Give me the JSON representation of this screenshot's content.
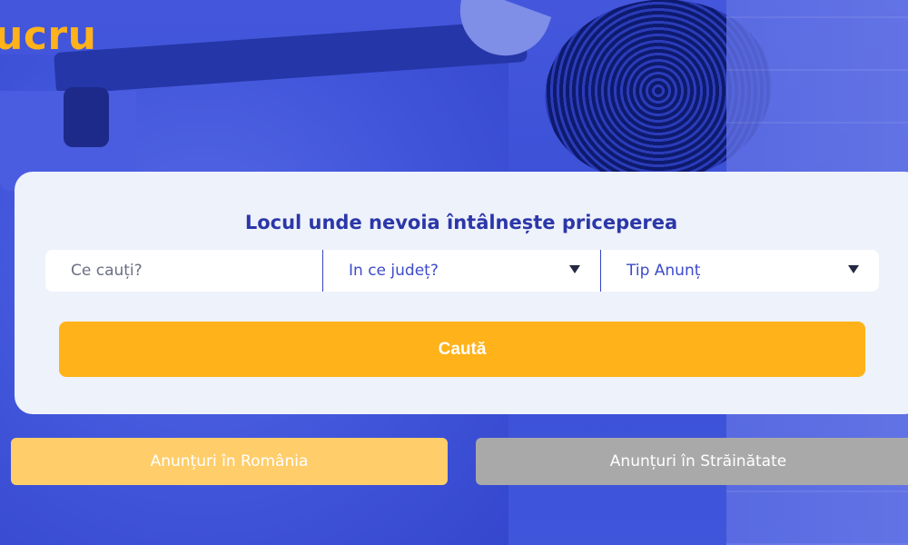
{
  "brand": {
    "logo_text": "ucru",
    "accent_color": "#ffb21a",
    "primary_color": "#2b37a8"
  },
  "search_card": {
    "title": "Locul unde nevoia întâlnește priceperea",
    "query_placeholder": "Ce cauți?",
    "county_select": {
      "label": "In ce județ?",
      "icon": "chevron-down-icon"
    },
    "type_select": {
      "label": "Tip Anunț",
      "icon": "chevron-down-icon"
    },
    "submit_label": "Caută"
  },
  "listing_tabs": {
    "romania_label": "Anunțuri în România",
    "abroad_label": "Anunțuri în Străinătate"
  }
}
